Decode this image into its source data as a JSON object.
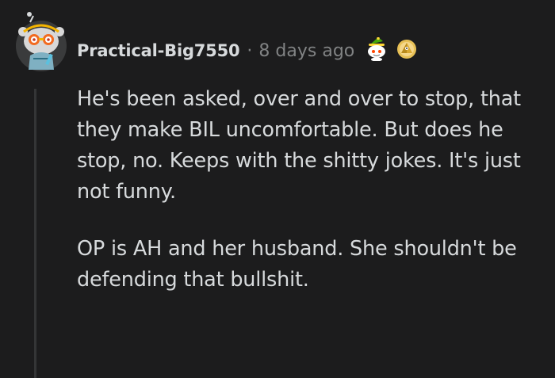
{
  "comment": {
    "username": "Practical-Big7550",
    "separator": "·",
    "timestamp": "8 days ago",
    "paragraphs": [
      "He's been asked, over and over to stop, that they make BIL uncomfortable. But does he stop, no. Keeps with the shitty jokes. It's just not funny.",
      "OP is AH and her husband. She shouldn't be defending that bullshit."
    ],
    "awards": [
      "elf-hat-snoo-award",
      "golden-pyramid-award"
    ]
  },
  "colors": {
    "background": "#1c1c1d",
    "text": "#d7dadc",
    "meta": "#818384",
    "thread_line": "#343536"
  }
}
